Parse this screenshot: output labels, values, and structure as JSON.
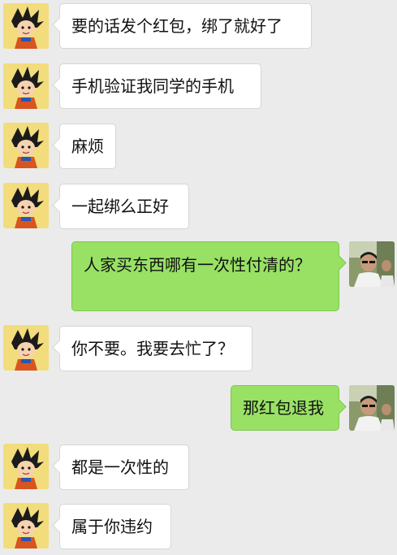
{
  "colors": {
    "background": "#ebebeb",
    "incoming_bubble": "#ffffff",
    "outgoing_bubble": "#98e165"
  },
  "messages": [
    {
      "side": "left",
      "text": "要的话发个红包，绑了就好了",
      "avatar": "cartoon-boy-avatar"
    },
    {
      "side": "left",
      "text": "手机验证我同学的手机",
      "avatar": "cartoon-boy-avatar"
    },
    {
      "side": "left",
      "text": "麻烦",
      "avatar": "cartoon-boy-avatar"
    },
    {
      "side": "left",
      "text": "一起绑么正好",
      "avatar": "cartoon-boy-avatar"
    },
    {
      "side": "right",
      "text": "人家买东西哪有一次性付清的？",
      "avatar": "photo-avatar"
    },
    {
      "side": "left",
      "text": "你不要。我要去忙了？",
      "avatar": "cartoon-boy-avatar"
    },
    {
      "side": "right",
      "text": "那红包退我",
      "avatar": "photo-avatar"
    },
    {
      "side": "left",
      "text": "都是一次性的",
      "avatar": "cartoon-boy-avatar"
    },
    {
      "side": "left",
      "text": "属于你违约",
      "avatar": "cartoon-boy-avatar"
    }
  ]
}
